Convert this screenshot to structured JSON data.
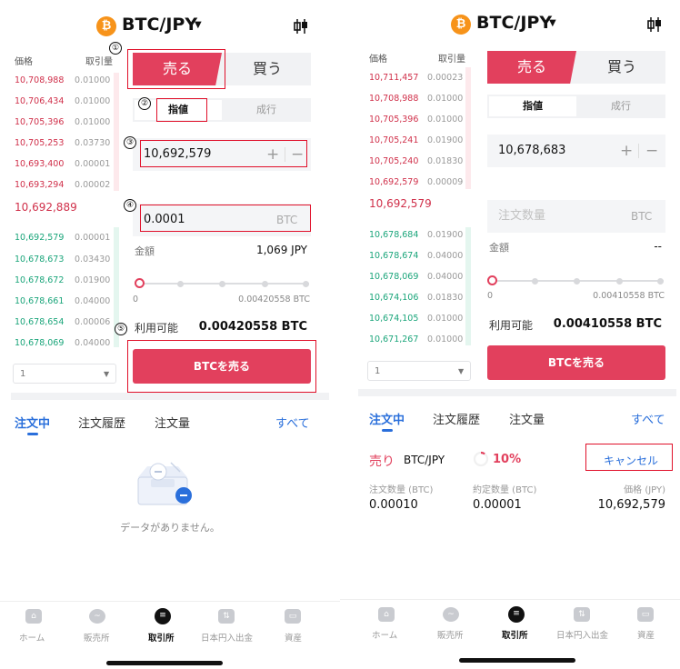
{
  "left": {
    "header": {
      "badge": "₿",
      "pair": "BTC/JPY"
    },
    "orderbook": {
      "price_header": "価格",
      "qty_header": "取引量",
      "sell": [
        {
          "price": "10,708,988",
          "qty": "0.01000"
        },
        {
          "price": "10,706,434",
          "qty": "0.01000"
        },
        {
          "price": "10,705,396",
          "qty": "0.01000"
        },
        {
          "price": "10,705,253",
          "qty": "0.03730"
        },
        {
          "price": "10,693,400",
          "qty": "0.00001"
        },
        {
          "price": "10,693,294",
          "qty": "0.00002"
        }
      ],
      "mid": "10,692,889",
      "buy": [
        {
          "price": "10,692,579",
          "qty": "0.00001"
        },
        {
          "price": "10,678,673",
          "qty": "0.03430"
        },
        {
          "price": "10,678,672",
          "qty": "0.01900"
        },
        {
          "price": "10,678,661",
          "qty": "0.04000"
        },
        {
          "price": "10,678,654",
          "qty": "0.00006"
        },
        {
          "price": "10,678,069",
          "qty": "0.04000"
        }
      ],
      "depth_select": "1"
    },
    "form": {
      "sell_label": "売る",
      "buy_label": "買う",
      "limit_label": "指値",
      "market_label": "成行",
      "price_value": "10,692,579",
      "plus": "+",
      "minus": "−",
      "qty_value": "0.0001",
      "qty_unit": "BTC",
      "amount_label": "金額",
      "amount_value": "1,069 JPY",
      "slider_min": "0",
      "slider_max": "0.00420558 BTC",
      "slider_percent": 0,
      "available_label": "利用可能",
      "available_value": "0.00420558 BTC",
      "submit_label": "BTCを売る"
    },
    "steps": [
      "①",
      "②",
      "③",
      "④",
      "⑤"
    ],
    "tabs": {
      "open": "注文中",
      "history": "注文履歴",
      "volume": "注文量",
      "all": "すべて"
    },
    "empty": "データがありません。"
  },
  "right": {
    "header": {
      "badge": "₿",
      "pair": "BTC/JPY"
    },
    "orderbook": {
      "price_header": "価格",
      "qty_header": "取引量",
      "sell": [
        {
          "price": "10,711,457",
          "qty": "0.00023"
        },
        {
          "price": "10,708,988",
          "qty": "0.01000"
        },
        {
          "price": "10,705,396",
          "qty": "0.01000"
        },
        {
          "price": "10,705,241",
          "qty": "0.01900"
        },
        {
          "price": "10,705,240",
          "qty": "0.01830"
        },
        {
          "price": "10,692,579",
          "qty": "0.00009"
        }
      ],
      "mid": "10,692,579",
      "buy": [
        {
          "price": "10,678,684",
          "qty": "0.01900"
        },
        {
          "price": "10,678,674",
          "qty": "0.04000"
        },
        {
          "price": "10,678,069",
          "qty": "0.04000"
        },
        {
          "price": "10,674,106",
          "qty": "0.01830"
        },
        {
          "price": "10,674,105",
          "qty": "0.01000"
        },
        {
          "price": "10,671,267",
          "qty": "0.01000"
        }
      ],
      "depth_select": "1"
    },
    "form": {
      "sell_label": "売る",
      "buy_label": "買う",
      "limit_label": "指値",
      "market_label": "成行",
      "price_value": "10,678,683",
      "plus": "+",
      "minus": "−",
      "qty_placeholder": "注文数量",
      "qty_unit": "BTC",
      "amount_label": "金額",
      "amount_value": "--",
      "slider_min": "0",
      "slider_max": "0.00410558 BTC",
      "slider_percent": 0,
      "available_label": "利用可能",
      "available_value": "0.00410558 BTC",
      "submit_label": "BTCを売る"
    },
    "tabs": {
      "open": "注文中",
      "history": "注文履歴",
      "volume": "注文量",
      "all": "すべて"
    },
    "order": {
      "side": "売り",
      "pair": "BTC/JPY",
      "progress": "10%",
      "progress_fraction": 0.1,
      "cancel": "キャンセル",
      "qty_label": "注文数量 (BTC)",
      "filled_label": "約定数量 (BTC)",
      "price_label": "価格 (JPY)",
      "qty_value": "0.00010",
      "filled_value": "0.00001",
      "price_value": "10,692,579"
    }
  },
  "bottom_nav": [
    {
      "label": "ホーム",
      "icon": "home-icon"
    },
    {
      "label": "販売所",
      "icon": "exchange-icon"
    },
    {
      "label": "取引所",
      "icon": "coin-stack-icon",
      "active": true
    },
    {
      "label": "日本円入出金",
      "icon": "yen-transfer-icon"
    },
    {
      "label": "資産",
      "icon": "wallet-icon"
    }
  ],
  "colors": {
    "sell_red": "#e2405d",
    "buy_green": "#1aa57a",
    "link_blue": "#2a6fdb",
    "highlight_box": "#e0102a",
    "bitcoin_orange": "#f7931a"
  }
}
